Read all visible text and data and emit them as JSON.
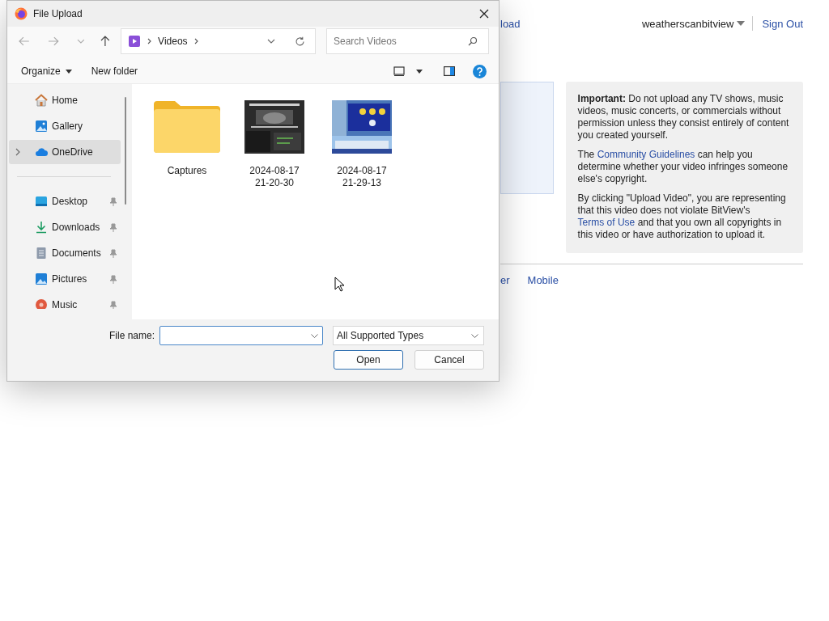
{
  "page": {
    "header_link": "load",
    "user": "weatherscanbitview",
    "sign_out": "Sign Out",
    "notice": [
      [
        {
          "text": "**Important:** Do not upload any TV shows, music videos, music concerts, or commercials without permission unless they consist entirely of content you created yourself."
        }
      ],
      [
        {
          "text": "The "
        },
        {
          "link": "Community Guidelines"
        },
        {
          "text": " can help you determine whether your video infringes someone else's copyright."
        }
      ],
      [
        {
          "text": "By clicking \"Upload Video\", you are representing that this video does not violate BitView's "
        },
        {
          "link": "Terms of Use"
        },
        {
          "text": " and that you own all copyrights in this video or have authorization to upload it."
        }
      ]
    ],
    "footer_links": [
      "er",
      "Mobile"
    ]
  },
  "dialog": {
    "title": "File Upload",
    "address": "Videos",
    "search": {
      "placeholder": "Search Videos"
    },
    "toolbar": {
      "organize": "Organize",
      "new_folder": "New folder"
    },
    "sidebar": [
      [
        {
          "label": "Home",
          "kind": "home",
          "selected": false,
          "pinned": false,
          "expandable": false
        },
        {
          "label": "Gallery",
          "kind": "gallery",
          "selected": false,
          "pinned": false,
          "expandable": false
        },
        {
          "label": "OneDrive",
          "kind": "cloud",
          "selected": true,
          "pinned": false,
          "expandable": true
        }
      ],
      [
        {
          "label": "Desktop",
          "kind": "desktop",
          "selected": false,
          "pinned": true,
          "expandable": false
        },
        {
          "label": "Downloads",
          "kind": "download",
          "selected": false,
          "pinned": true,
          "expandable": false
        },
        {
          "label": "Documents",
          "kind": "document",
          "selected": false,
          "pinned": true,
          "expandable": false
        },
        {
          "label": "Pictures",
          "kind": "pictures",
          "selected": false,
          "pinned": true,
          "expandable": false
        },
        {
          "label": "Music",
          "kind": "music",
          "selected": false,
          "pinned": true,
          "expandable": false
        }
      ]
    ],
    "files": [
      {
        "name": "Captures",
        "kind": "folder"
      },
      {
        "name": "2024-08-17 21-20-30",
        "kind": "video"
      },
      {
        "name": "2024-08-17 21-29-13",
        "kind": "video"
      }
    ],
    "file_name_label": "File name:",
    "file_type": "All Supported Types",
    "buttons": [
      {
        "label": "Open",
        "default": true
      },
      {
        "label": "Cancel",
        "default": false
      }
    ]
  }
}
